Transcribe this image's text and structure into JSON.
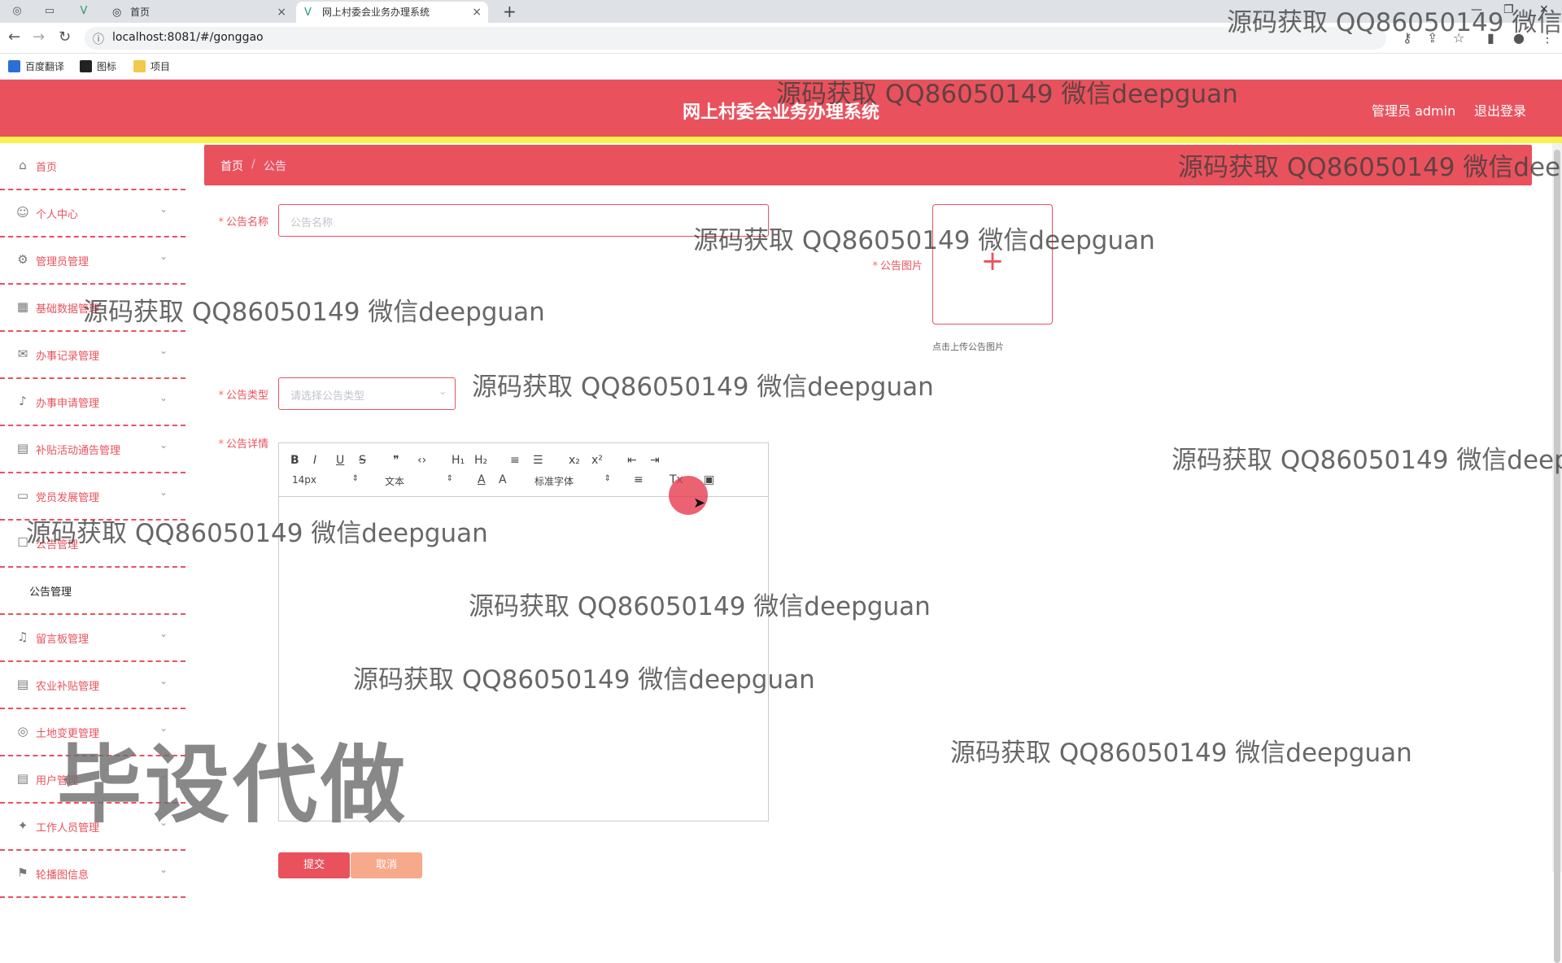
{
  "browser": {
    "tabs": [
      {
        "icon": "globe-icon",
        "title": "首页",
        "close": "×"
      },
      {
        "icon": "vue-icon",
        "title": "网上村委会业务办理系统",
        "close": "×"
      }
    ],
    "new_tab": "+",
    "url": "localhost:8081/#/gonggao",
    "bookmarks": [
      "百度翻译",
      "图标",
      "项目"
    ]
  },
  "header": {
    "title": "网上村委会业务办理系统",
    "user": "管理员 admin",
    "logout": "退出登录",
    "color": "#e9525d",
    "strip_color": "#f7f24c"
  },
  "sidebar": {
    "items": [
      {
        "icon": "home-icon",
        "label": "首页",
        "arrow": ""
      },
      {
        "icon": "user-icon",
        "label": "个人中心",
        "arrow": "⌄"
      },
      {
        "icon": "admin-icon",
        "label": "管理员管理",
        "arrow": "⌄"
      },
      {
        "icon": "grid-icon",
        "label": "基础数据管理",
        "arrow": "⌄"
      },
      {
        "icon": "mail-icon",
        "label": "办事记录管理",
        "arrow": "⌄"
      },
      {
        "icon": "mic-icon",
        "label": "办事申请管理",
        "arrow": "⌄"
      },
      {
        "icon": "clipboard-icon",
        "label": "补贴活动通告管理",
        "arrow": "⌄"
      },
      {
        "icon": "monitor-icon",
        "label": "党员发展管理",
        "arrow": "⌄"
      },
      {
        "icon": "chat-icon",
        "label": "公告管理",
        "arrow": "⌄"
      }
    ],
    "sub_item": "公告管理",
    "items_after": [
      {
        "icon": "bell-icon",
        "label": "留言板管理",
        "arrow": "⌄"
      },
      {
        "icon": "clipboard-icon",
        "label": "农业补贴管理",
        "arrow": "⌄"
      },
      {
        "icon": "target-icon",
        "label": "土地变更管理",
        "arrow": "⌄"
      },
      {
        "icon": "clipboard-icon",
        "label": "用户管理",
        "arrow": "⌄"
      },
      {
        "icon": "worker-icon",
        "label": "工作人员管理",
        "arrow": "⌄"
      },
      {
        "icon": "flag-icon",
        "label": "轮播图信息",
        "arrow": "⌄"
      }
    ]
  },
  "breadcrumb": {
    "home": "首页",
    "sep": "/",
    "current": "公告"
  },
  "form": {
    "name_label": "公告名称",
    "name_placeholder": "公告名称",
    "image_label": "公告图片",
    "upload_plus": "+",
    "upload_hint": "点击上传公告图片",
    "type_label": "公告类型",
    "type_placeholder": "请选择公告类型",
    "detail_label": "公告详情",
    "required_mark": "*",
    "submit": "提交",
    "cancel": "取消"
  },
  "editor": {
    "buttons": [
      "B",
      "I",
      "U",
      "S",
      "❞",
      "‹›",
      "H₁",
      "H₂",
      "≡",
      "☰",
      "x₂",
      "x²",
      "⇤",
      "⇥"
    ],
    "size": "14px",
    "format": "文本",
    "font": "标准字体",
    "tools2": [
      "A",
      "A",
      "≡",
      "Tx",
      "▣"
    ]
  },
  "watermarks": {
    "text": "源码获取 QQ86050149 微信deepguan",
    "stamp": "毕设代做"
  }
}
